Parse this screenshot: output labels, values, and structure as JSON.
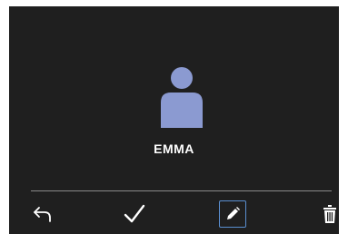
{
  "profile": {
    "name": "EMMA",
    "avatar_icon": "person-icon",
    "avatar_color": "#8b9ad1"
  },
  "toolbar": {
    "buttons": [
      {
        "id": "back",
        "icon": "back-arrow-icon"
      },
      {
        "id": "confirm",
        "icon": "checkmark-icon"
      },
      {
        "id": "edit",
        "icon": "pencil-icon",
        "selected": true
      },
      {
        "id": "delete",
        "icon": "trash-icon"
      }
    ]
  },
  "colors": {
    "screen_background": "#1f1f1f",
    "text": "#ffffff",
    "divider": "#8a8a8a",
    "selection_border": "#5a8fd0"
  }
}
